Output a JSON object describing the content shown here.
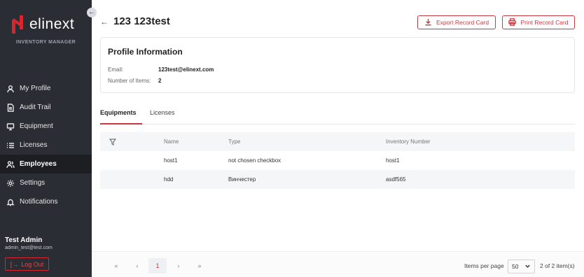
{
  "app": {
    "logo_text": "elinext",
    "subtitle": "INVENTORY MANAGER",
    "brand_color": "#d7262e"
  },
  "sidebar": {
    "items": [
      {
        "label": "My Profile",
        "icon": "user-icon",
        "active": false
      },
      {
        "label": "Audit Trail",
        "icon": "document-icon",
        "active": false
      },
      {
        "label": "Equipment",
        "icon": "monitor-icon",
        "active": false
      },
      {
        "label": "Licenses",
        "icon": "list-icon",
        "active": false
      },
      {
        "label": "Employees",
        "icon": "users-icon",
        "active": true
      },
      {
        "label": "Settings",
        "icon": "gear-icon",
        "active": false
      },
      {
        "label": "Notifications",
        "icon": "bell-icon",
        "active": false
      }
    ],
    "user": {
      "name": "Test Admin",
      "email": "admin_test@test.com"
    },
    "logout_label": "Log Out"
  },
  "header": {
    "title": "123 123test",
    "export_label": "Export Record Card",
    "print_label": "Print Record Card"
  },
  "profile": {
    "title": "Profile Information",
    "email_label": "Email:",
    "email_value": "123test@elinext.com",
    "items_label": "Number of Items:",
    "items_value": "2"
  },
  "tabs": [
    {
      "label": "Equipments",
      "active": true
    },
    {
      "label": "Licenses",
      "active": false
    }
  ],
  "table": {
    "columns": [
      "Name",
      "Type",
      "Inventory Number"
    ],
    "rows": [
      {
        "name": "host1",
        "type": "not chosen checkbox",
        "inventory": "host1"
      },
      {
        "name": "hdd",
        "type": "Винчестер",
        "inventory": "asdf565"
      }
    ]
  },
  "pagination": {
    "first": "«",
    "prev": "‹",
    "current_page": "1",
    "next": "›",
    "last": "»",
    "items_per_page_label": "Items per page",
    "items_per_page_value": "50",
    "count_text": "2 of 2 item(s)"
  }
}
